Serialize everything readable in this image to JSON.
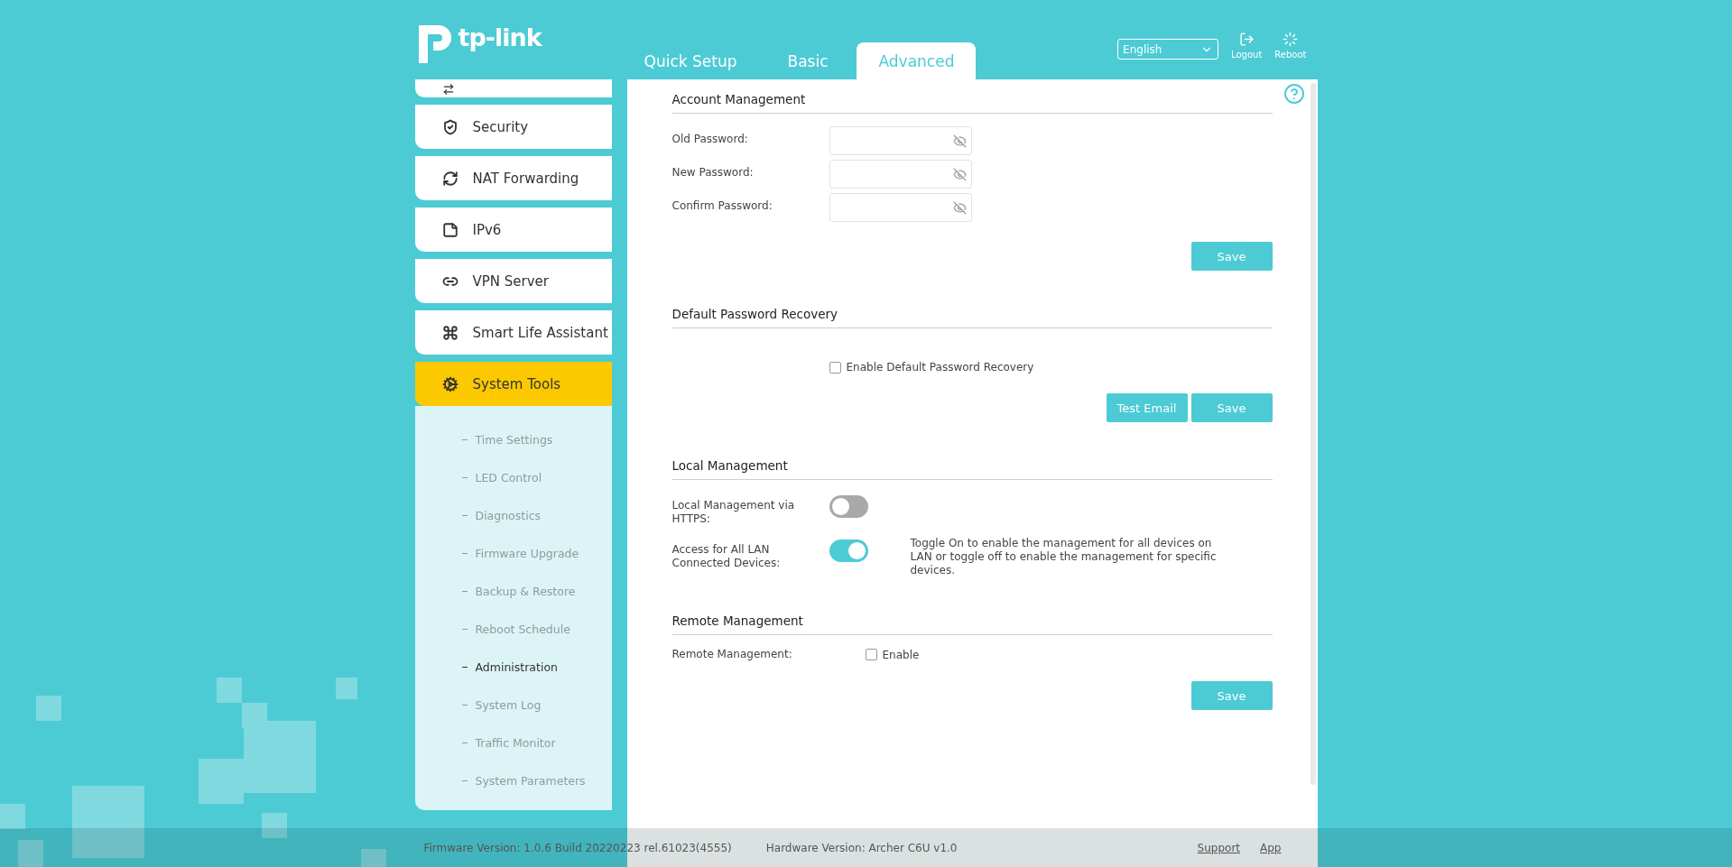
{
  "header": {
    "logo": "tp-link",
    "tabs": [
      {
        "label": "Quick Setup",
        "selected": false
      },
      {
        "label": "Basic",
        "selected": false
      },
      {
        "label": "Advanced",
        "selected": true
      }
    ],
    "language": "English",
    "actions": [
      {
        "kind": "logout",
        "label": "Logout"
      },
      {
        "kind": "reboot",
        "label": "Reboot"
      }
    ]
  },
  "sidebar": {
    "items": [
      {
        "kind": "security",
        "label": "Security",
        "selected": false
      },
      {
        "kind": "nat",
        "label": "NAT Forwarding",
        "selected": false
      },
      {
        "kind": "ipv6",
        "label": "IPv6",
        "selected": false
      },
      {
        "kind": "vpn",
        "label": "VPN Server",
        "selected": false
      },
      {
        "kind": "smart-life",
        "label": "Smart Life Assistant",
        "selected": false
      },
      {
        "kind": "system-tools",
        "label": "System Tools",
        "selected": true,
        "expanded": true,
        "children": [
          {
            "label": "Time Settings",
            "selected": false
          },
          {
            "label": "LED Control",
            "selected": false
          },
          {
            "label": "Diagnostics",
            "selected": false
          },
          {
            "label": "Firmware Upgrade",
            "selected": false
          },
          {
            "label": "Backup & Restore",
            "selected": false
          },
          {
            "label": "Reboot Schedule",
            "selected": false
          },
          {
            "label": "Administration",
            "selected": true
          },
          {
            "label": "System Log",
            "selected": false
          },
          {
            "label": "Traffic Monitor",
            "selected": false
          },
          {
            "label": "System Parameters",
            "selected": false
          }
        ]
      }
    ]
  },
  "sections": [
    {
      "title": "Account Management",
      "fields": [
        {
          "label": "Old Password:"
        },
        {
          "label": "New Password:"
        },
        {
          "label": "Confirm Password:"
        }
      ],
      "buttons": [
        "Save"
      ]
    },
    {
      "title": "Default Password Recovery",
      "checkbox": {
        "label": "Enable Default Password Recovery",
        "checked": false
      },
      "buttons": [
        "Test Email",
        "Save"
      ]
    },
    {
      "title": "Local Management",
      "toggles": [
        {
          "label": "Local Management via HTTPS:",
          "on": false
        },
        {
          "label": "Access for All LAN Connected Devices:",
          "on": true,
          "note": "Toggle On to enable the management for all devices on LAN or toggle off to enable the management for specific devices."
        }
      ]
    },
    {
      "title": "Remote Management",
      "rows": [
        {
          "label": "Remote Management:",
          "checkbox": {
            "label": "Enable",
            "checked": false
          }
        }
      ],
      "buttons": [
        "Save"
      ]
    }
  ],
  "footer": {
    "firmware": "Firmware Version: 1.0.6 Build 20220223 rel.61023(4555)",
    "hardware": "Hardware Version: Archer C6U v1.0",
    "links": [
      "Support",
      "App"
    ]
  }
}
